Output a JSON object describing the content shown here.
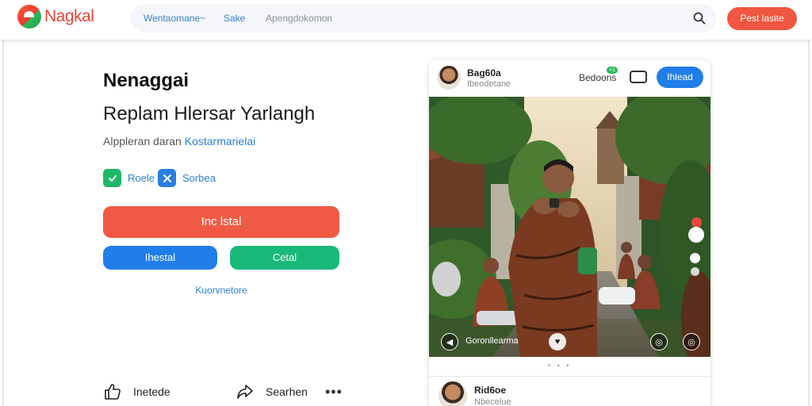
{
  "header": {
    "logo_text": "Nagkal",
    "nav": [
      "Wentaomane~",
      "Sake",
      "Apengdokomon"
    ],
    "cta_label": "Pest lasite",
    "brand_color": "#f05640"
  },
  "hero": {
    "title": "Nenaggai",
    "subtitle": "Replam Hlersar Yarlangh",
    "tagline_prefix": "Alppleran daran",
    "tagline_accent": "Kostarmarielai",
    "chips": [
      {
        "icon": "check-icon",
        "label": "Roele"
      },
      {
        "icon": "tools-icon",
        "label": "Sorbea"
      }
    ],
    "primary_button": "Inc lstal",
    "secondary_button": "Ihestal",
    "tertiary_button": "Cetal",
    "link": "Kuorvnetore"
  },
  "actions": {
    "like_label": "Inetede",
    "share_label": "Searhen",
    "more_label": "•••"
  },
  "post": {
    "name": "Bag60a",
    "handle": "Ibeodetane",
    "count_label": "Bedoons",
    "badge": "+1",
    "follow_label": "Ihlead",
    "overlay_caption": "Goronllearma",
    "pager": "• • •"
  },
  "next_post": {
    "name": "Rid6oe",
    "handle": "Nbecelue"
  }
}
